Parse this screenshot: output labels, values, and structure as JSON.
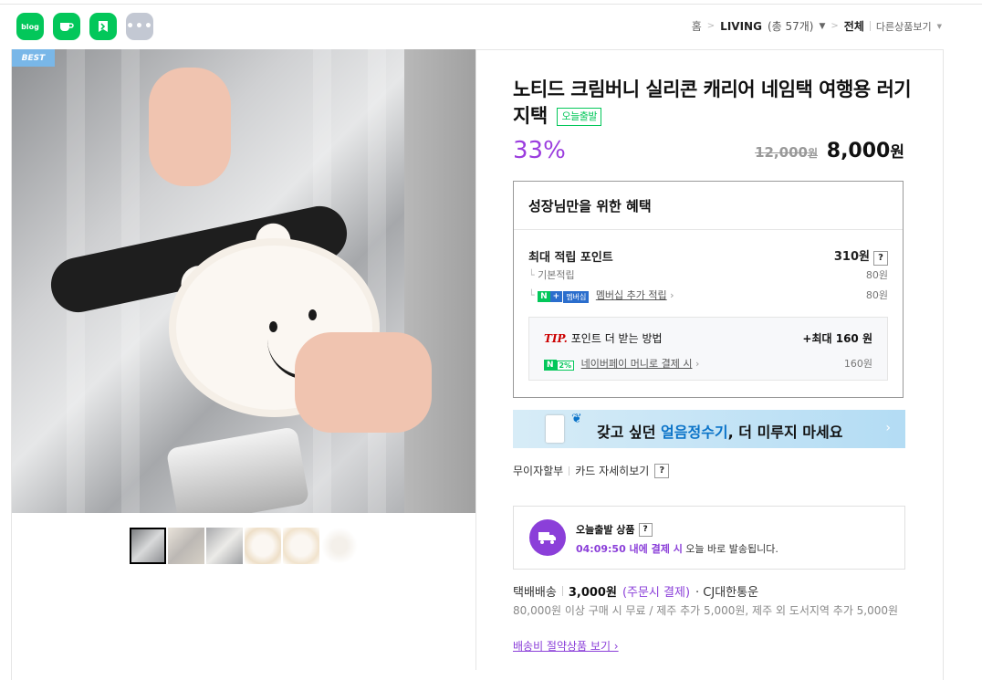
{
  "shortcuts": {
    "blog": "blog",
    "cafe": "cafe-icon",
    "kin": "k-icon",
    "more": "•••"
  },
  "breadcrumb": {
    "home": "홈",
    "category": "LIVING",
    "count": "(총 57개)",
    "all": "전체",
    "other": "다른상품보기"
  },
  "product": {
    "badge": "BEST",
    "title": "노티드 크림버니 실리콘 캐리어 네임택 여행용 러기지택",
    "today_badge": "오늘출발",
    "discount": "33%",
    "original_price": "12,000",
    "original_unit": "원",
    "price": "8,000",
    "price_unit": "원"
  },
  "benefit": {
    "heading": "성장님만을 위한 혜택",
    "max_points_label": "최대 적립 포인트",
    "max_points_value": "310원",
    "help": "?",
    "basic_label": "기본적립",
    "basic_value": "80원",
    "membership_n": "N",
    "membership_plus": "+",
    "membership_tag": "멤버십",
    "membership_label": "멤버십 추가 적립",
    "membership_value": "80원",
    "tip_word": "TIP.",
    "tip_label": "포인트 더 받는 방법",
    "tip_max": "+최대 160 원",
    "pay_n": "N",
    "pay_pct": "2%",
    "pay_label": "네이버페이 머니로 결제 시",
    "pay_value": "160원"
  },
  "banner": {
    "text_prefix": "갖고 싶던 ",
    "text_highlight": "얼음정수기",
    "text_suffix": ", 더 미루지 마세요",
    "arrow": "›"
  },
  "card": {
    "installment": "무이자할부",
    "card_detail": "카드 자세히보기",
    "help": "?"
  },
  "today": {
    "title": "오늘출발 상품",
    "help": "?",
    "time": "04:09:50 내에 결제 시",
    "rest": " 오늘 바로 발송됩니다."
  },
  "shipping": {
    "method": "택배배송",
    "fee": "3,000원",
    "condition": "(주문시 결제)",
    "carrier": "· CJ대한통운",
    "note": "80,000원 이상 구매 시 무료 / 제주 추가 5,000원, 제주 외 도서지역 추가 5,000원",
    "link": "배송비 절약상품 보기 ›"
  }
}
